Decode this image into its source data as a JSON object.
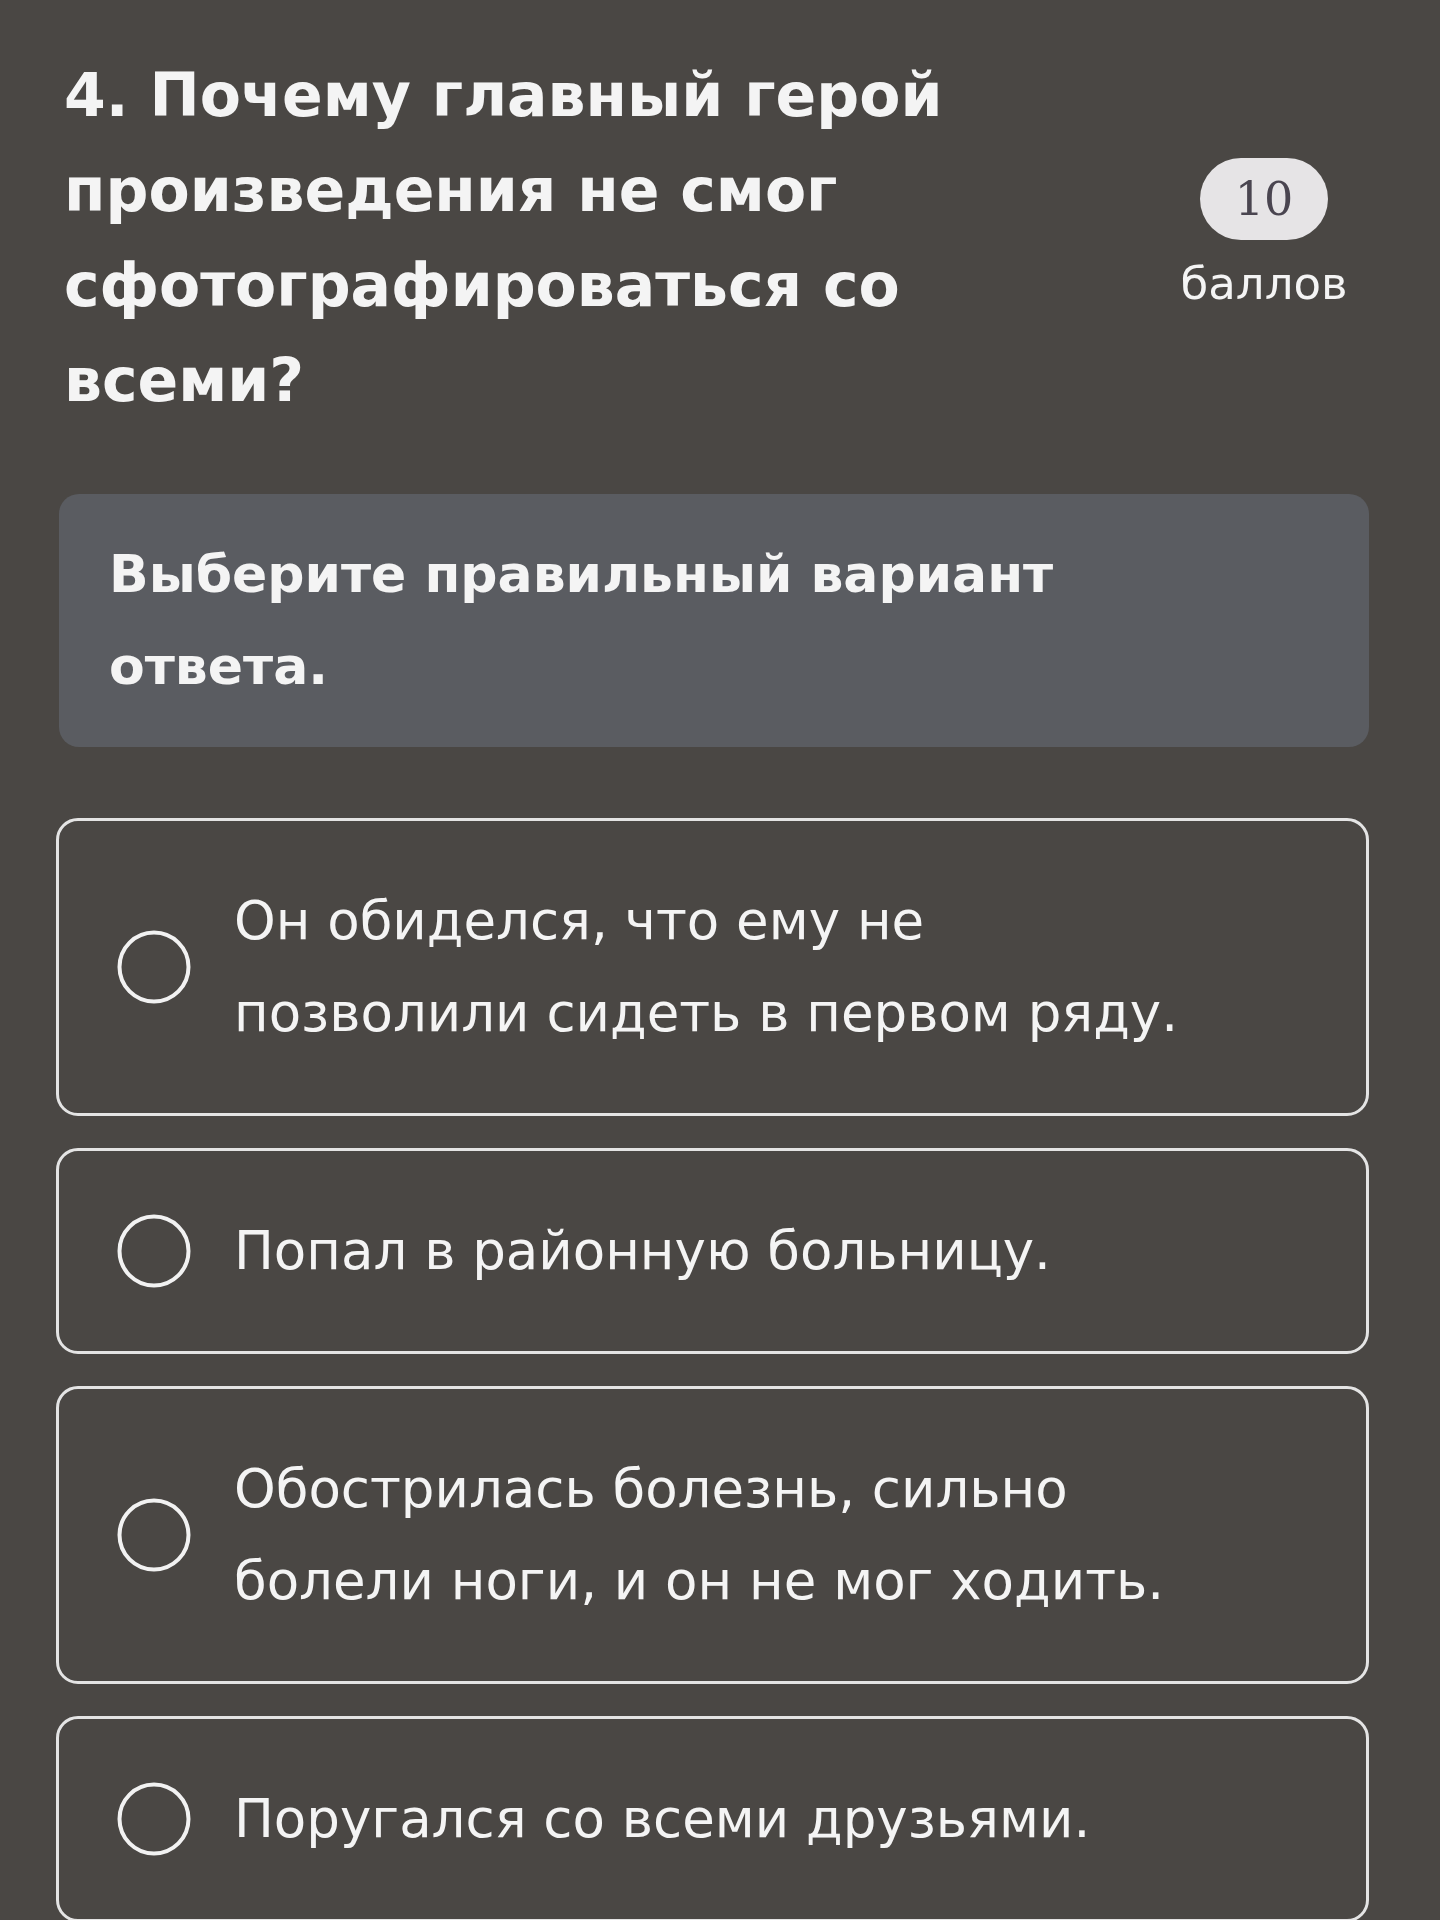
{
  "question": {
    "title": "4. Почему главный герой произведения не смог сфотографироваться со всеми?"
  },
  "points": {
    "value": "10",
    "label": "баллов"
  },
  "instruction": "Выберите правильный вариант ответа.",
  "options": [
    {
      "text": "Он обиделся, что ему не позволили сидеть в первом ряду.",
      "selected": false
    },
    {
      "text": "Попал в районную больницу.",
      "selected": false
    },
    {
      "text": "Обострилась болезнь, сильно болели ноги, и он не мог ходить.",
      "selected": false
    },
    {
      "text": "Поругался со всеми друзьями.",
      "selected": false
    }
  ]
}
